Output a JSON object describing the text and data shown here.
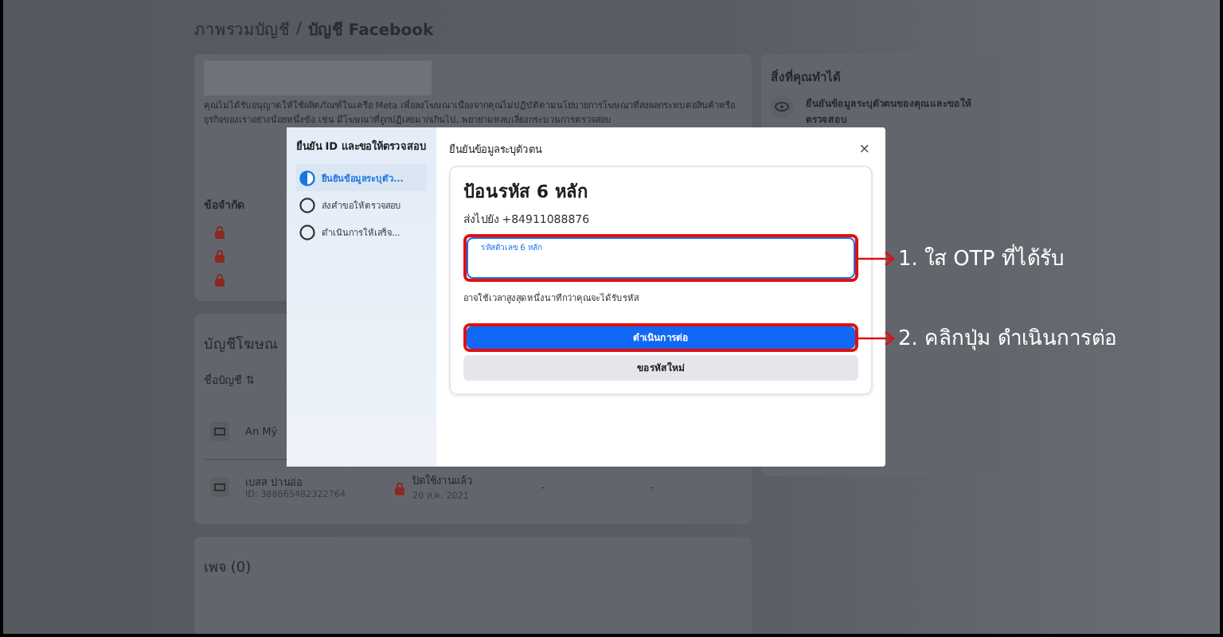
{
  "breadcrumb": {
    "parent": "ภาพรวมบัญชี",
    "separator": "/",
    "current": "บัญชี Facebook"
  },
  "notice": {
    "text": "คุณไม่ได้รับอนุญาตให้ใช้ผลิตภัณฑ์ในเครือ Meta เพื่อลงโฆษณาเนื่องจากคุณไม่ปฏิบัติตามนโยบายการโฆษณาที่ส่งผลกระทบต่อสินค้าหรือธุรกิจของเราอย่างน้อยหนึ่งข้อ เช่น มีโฆษณาที่ถูกปฏิเสธมากเกินไป, พยายามหลบเลี่ยงกระบวนการตรวจสอบ"
  },
  "restrictions": {
    "title": "ข้อจำกัด"
  },
  "ad_accounts": {
    "title": "บัญชีโฆษณ",
    "column": "ชื่อบัญชี ⇅",
    "rows": [
      {
        "name": "An Mỹ"
      },
      {
        "name": "เบสส ปานอ่อ",
        "id": "ID: 388665482322764",
        "status": "ปิดใช้งานแล้ว",
        "date": "20 ส.ค. 2021",
        "column_3": "-",
        "column_4": "-"
      }
    ]
  },
  "pages": {
    "title": "เพจ (0)"
  },
  "side_card": {
    "title": "สิ่งที่คุณทำได้",
    "item": "ยืนยันข้อมูลระบุตัวตนของคุณและขอให้ตรวจสอบ"
  },
  "modal": {
    "sidebar_title": "ยืนยัน ID และขอให้ตรวจสอบ",
    "steps": [
      {
        "label": "ยืนยันข้อมูลระบุตัว...",
        "selected": true
      },
      {
        "label": "ส่งคำขอให้ตรวจสอบ",
        "selected": false
      },
      {
        "label": "ดำเนินการให้เสร็จ...",
        "selected": false
      }
    ],
    "title": "ยืนยันข้อมูลระบุตัวตน",
    "close": "×",
    "heading": "ป้อนรหัส 6 หลัก",
    "sent_to": "ส่งไปยัง +84911088876",
    "code_field": {
      "placeholder": "รหัสตัวเลข 6 หลัก",
      "annotation": "1. ใส OTP ที่ได้รับ"
    },
    "hint": "อาจใช้เวลาสูงสุดหนึ่งนาทีกว่าคุณจะได้รับรหัส",
    "continue_button": {
      "label": "ดำเนินการต่อ",
      "annotation": "2. คลิกปุ่ม ดำเนินการต่อ"
    },
    "resend_button": {
      "label": "ขอรหัสใหม่"
    }
  }
}
